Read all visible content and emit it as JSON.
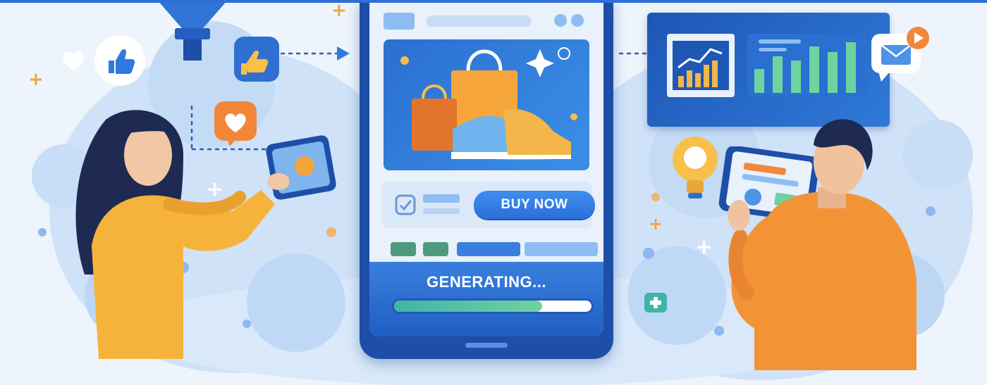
{
  "phone": {
    "buy_button_label": "BUY NOW",
    "status_label": "GENERATING...",
    "progress": 0.75
  },
  "colors": {
    "primary_blue": "#2a6fd9",
    "background": "#eef4fb",
    "accent_orange": "#f4a23a",
    "accent_yellow": "#f6b73c",
    "accent_green": "#6fd3a0"
  },
  "icons": [
    "thumbs-up-icon",
    "heart-icon",
    "like-hand-icon",
    "lightbulb-icon",
    "mail-icon",
    "play-icon",
    "plus-icon",
    "shopping-bag-icon",
    "sneaker-icon"
  ]
}
